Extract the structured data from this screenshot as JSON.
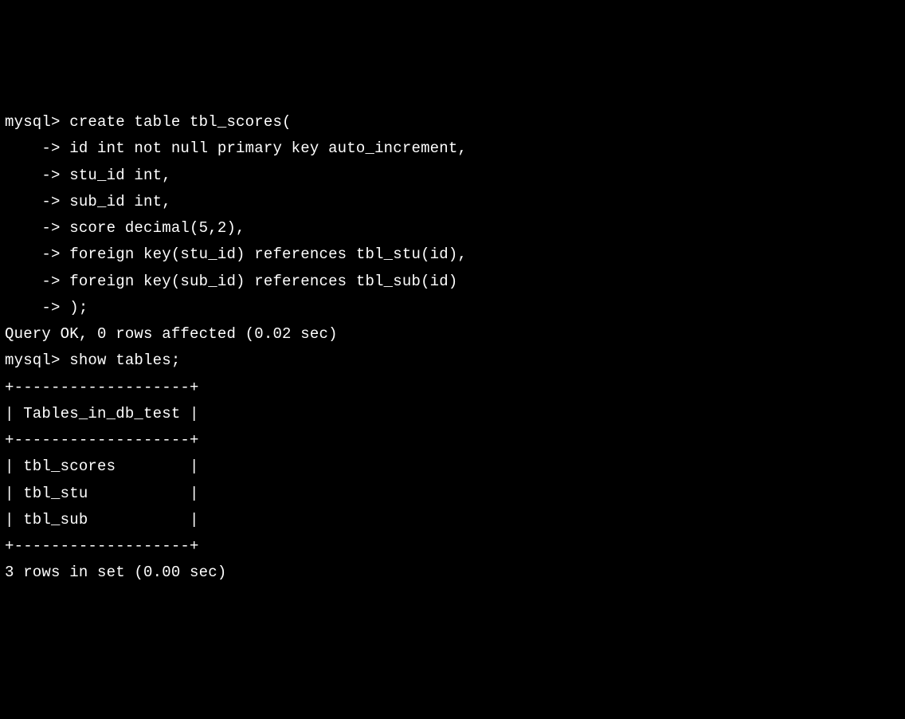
{
  "terminal": {
    "lines": [
      "mysql> create table tbl_scores(",
      "    -> id int not null primary key auto_increment,",
      "    -> stu_id int,",
      "    -> sub_id int,",
      "    -> score decimal(5,2),",
      "    -> foreign key(stu_id) references tbl_stu(id),",
      "    -> foreign key(sub_id) references tbl_sub(id)",
      "    -> );",
      "Query OK, 0 rows affected (0.02 sec)",
      "",
      "mysql> show tables;",
      "+-------------------+",
      "| Tables_in_db_test |",
      "+-------------------+",
      "| tbl_scores        |",
      "| tbl_stu           |",
      "| tbl_sub           |",
      "+-------------------+",
      "3 rows in set (0.00 sec)"
    ]
  }
}
